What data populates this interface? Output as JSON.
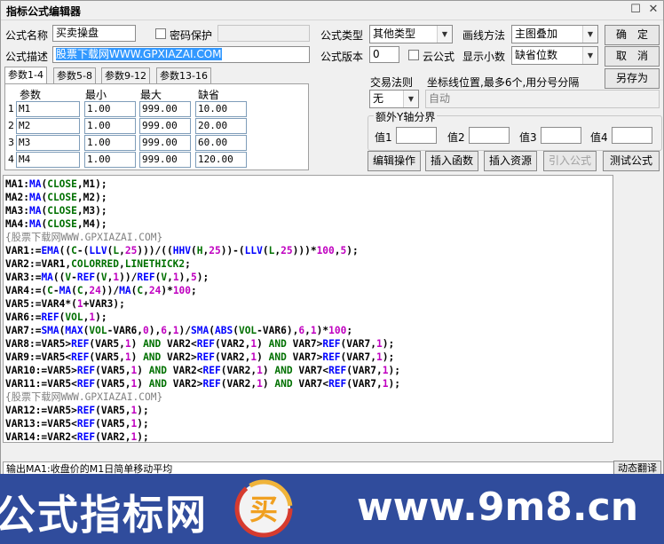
{
  "window": {
    "title": "指标公式编辑器",
    "restore_icon": "restore-icon",
    "close_icon": "close-icon"
  },
  "form": {
    "name_label": "公式名称",
    "name_value": "买卖操盘",
    "password_label": "密码保护",
    "password_value": "",
    "desc_label": "公式描述",
    "desc_value": "股票下载网WWW.GPXIAZAI.COM",
    "type_label": "公式类型",
    "type_value": "其他类型",
    "draw_label": "画线方法",
    "draw_value": "主图叠加",
    "version_label": "公式版本",
    "version_value": "0",
    "cloud_label": "云公式",
    "decimal_label": "显示小数",
    "decimal_value": "缺省位数",
    "trade_rule_label": "交易法则",
    "trade_rule_value": "无",
    "coord_label": "坐标线位置,最多6个,用分号分隔",
    "coord_value": "自动",
    "extra_axis_title": "额外Y轴分界",
    "extra_axis": [
      "值1",
      "值2",
      "值3",
      "值4"
    ]
  },
  "buttons": {
    "ok": "确　定",
    "cancel": "取　消",
    "save_as": "另存为",
    "edit_op": "编辑操作",
    "insert_fn": "插入函数",
    "insert_res": "插入资源",
    "import_formula": "引入公式",
    "test_formula": "测试公式",
    "dyn_translate": "动态翻译"
  },
  "tabs": [
    "参数1-4",
    "参数5-8",
    "参数9-12",
    "参数13-16"
  ],
  "params": {
    "headers": [
      "参数",
      "最小",
      "最大",
      "缺省"
    ],
    "rows": [
      {
        "num": "1",
        "name": "M1",
        "min": "1.00",
        "max": "999.00",
        "def": "10.00"
      },
      {
        "num": "2",
        "name": "M2",
        "min": "1.00",
        "max": "999.00",
        "def": "20.00"
      },
      {
        "num": "3",
        "name": "M3",
        "min": "1.00",
        "max": "999.00",
        "def": "60.00"
      },
      {
        "num": "4",
        "name": "M4",
        "min": "1.00",
        "max": "999.00",
        "def": "120.00"
      }
    ]
  },
  "code_lines": [
    "MA1:MA(CLOSE,M1);",
    "MA2:MA(CLOSE,M2);",
    "MA3:MA(CLOSE,M3);",
    "MA4:MA(CLOSE,M4);",
    "{股票下载网WWW.GPXIAZAI.COM}",
    "VAR1:=EMA((C-(LLV(L,25)))/((HHV(H,25))-(LLV(L,25)))*100,5);",
    "VAR2:=VAR1,COLORRED,LINETHICK2;",
    "VAR3:=MA((V-REF(V,1))/REF(V,1),5);",
    "VAR4:=(C-MA(C,24))/MA(C,24)*100;",
    "VAR5:=VAR4*(1+VAR3);",
    "VAR6:=REF(VOL,1);",
    "VAR7:=SMA(MAX(VOL-VAR6,0),6,1)/SMA(ABS(VOL-VAR6),6,1)*100;",
    "VAR8:=VAR5>REF(VAR5,1) AND VAR2<REF(VAR2,1) AND VAR7>REF(VAR7,1);",
    "VAR9:=VAR5<REF(VAR5,1) AND VAR2>REF(VAR2,1) AND VAR7>REF(VAR7,1);",
    "VAR10:=VAR5>REF(VAR5,1) AND VAR2<REF(VAR2,1) AND VAR7<REF(VAR7,1);",
    "VAR11:=VAR5<REF(VAR5,1) AND VAR2>REF(VAR2,1) AND VAR7<REF(VAR7,1);",
    "{股票下载网WWW.GPXIAZAI.COM}",
    "VAR12:=VAR5>REF(VAR5,1);",
    "VAR13:=VAR5<REF(VAR5,1);",
    "VAR14:=VAR2<REF(VAR2,1);"
  ],
  "status_text": "输出MA1:收盘价的M1日简单移动平均",
  "banner": {
    "left_text": "公式指标网",
    "right_text": "www.9m8.cn",
    "logo_char": "买",
    "logo_ring_text": "www.9m8.cn"
  },
  "colors": {
    "function": "#0000ff",
    "keyword": "#007000",
    "number": "#c000c0",
    "comment": "#808080",
    "banner_bg": "#304c9c",
    "desc_highlight": "#3399ff"
  }
}
